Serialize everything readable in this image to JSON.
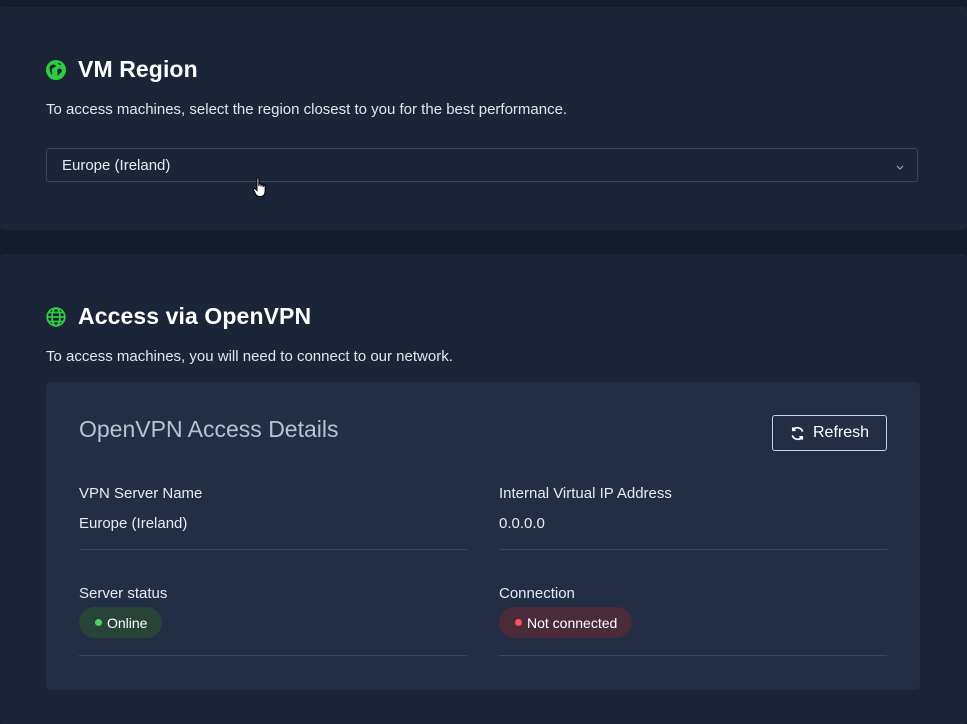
{
  "region": {
    "title": "VM Region",
    "description": "To access machines, select the region closest to you for the best performance.",
    "selected": "Europe (Ireland)",
    "icon": "globe-americas-icon"
  },
  "openvpn": {
    "title": "Access via OpenVPN",
    "description": "To access machines, you will need to connect to our network.",
    "icon": "globe-grid-icon",
    "panel": {
      "title": "OpenVPN Access Details",
      "refresh_label": "Refresh",
      "server_name_label": "VPN Server Name",
      "server_name_value": "Europe (Ireland)",
      "ip_label": "Internal Virtual IP Address",
      "ip_value": "0.0.0.0",
      "status_label": "Server status",
      "status_value": "Online",
      "connection_label": "Connection",
      "connection_value": "Not connected"
    }
  },
  "colors": {
    "background": "#141c2b",
    "card": "#1c2538",
    "panel": "#232e45",
    "accent_green": "#48d36a",
    "status_red": "#ff4f63"
  }
}
